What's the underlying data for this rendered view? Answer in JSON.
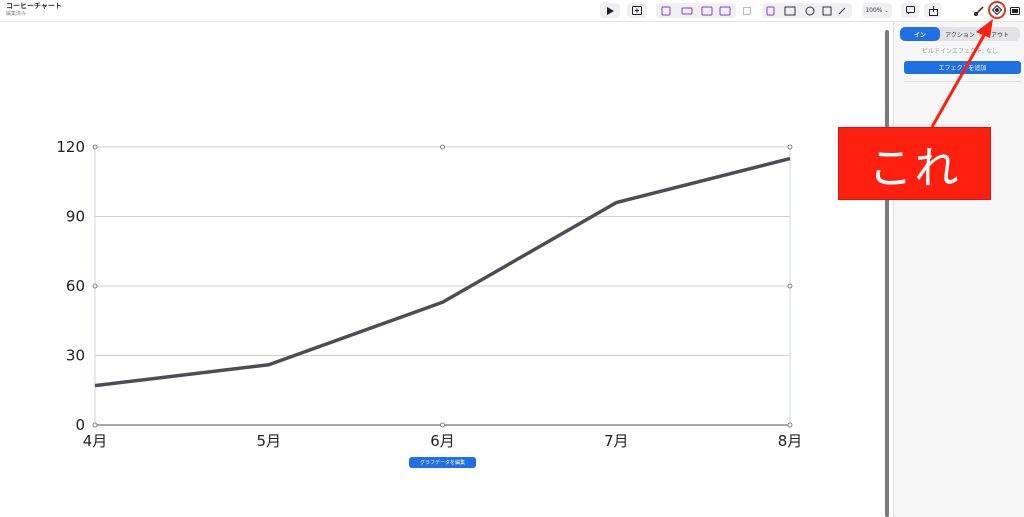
{
  "document": {
    "title": "コーヒーチャート",
    "status": "編集済み"
  },
  "toolbar": {
    "zoom_label": "100%",
    "icons": [
      "play-icon",
      "add-slide-icon",
      "text-icon",
      "shape-icon",
      "image-icon",
      "media-icon",
      "table-icon",
      "chart-icon",
      "comment-icon",
      "share-icon",
      "format-icon",
      "animate-icon",
      "document-icon"
    ]
  },
  "panel": {
    "tabs": [
      "イン",
      "アクション",
      "アウト"
    ],
    "active_tab": "イン",
    "build_in_label": "ビルドインエフェクト: なし",
    "add_effect_label": "エフェクトを追加"
  },
  "annotation": {
    "text": "これ",
    "color": "#ff1f0f"
  },
  "chart": {
    "edit_data_label": "グラフデータを編集"
  },
  "chart_data": {
    "type": "line",
    "categories": [
      "4月",
      "5月",
      "6月",
      "7月",
      "8月"
    ],
    "series": [
      {
        "values": [
          17,
          26,
          53,
          96,
          115
        ]
      }
    ],
    "ylim": [
      0,
      120
    ],
    "yticks": [
      0,
      30,
      60,
      90,
      120
    ],
    "grid": true,
    "line_color": "#4f4c55",
    "title": "",
    "xlabel": "",
    "ylabel": ""
  }
}
